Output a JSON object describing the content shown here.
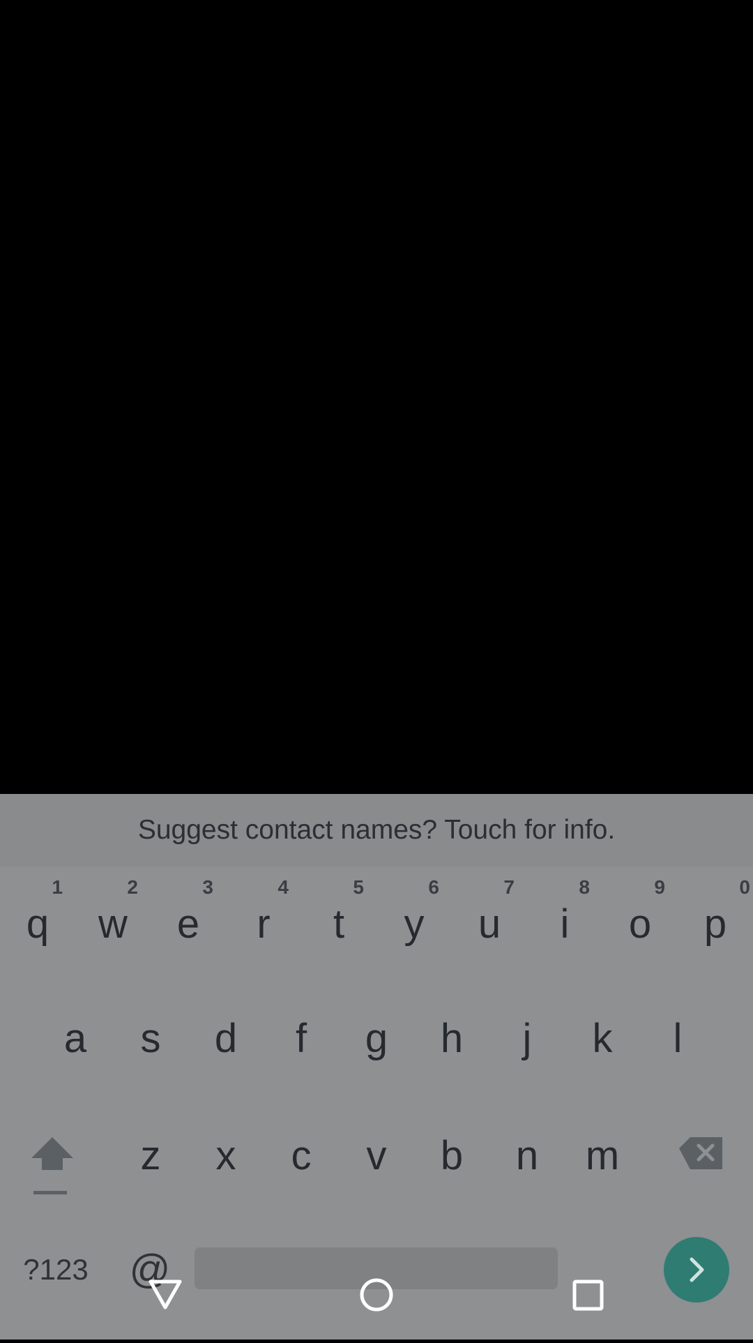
{
  "keyboard": {
    "suggestion": "Suggest contact names? Touch for info.",
    "row1": [
      {
        "letter": "q",
        "hint": "1"
      },
      {
        "letter": "w",
        "hint": "2"
      },
      {
        "letter": "e",
        "hint": "3"
      },
      {
        "letter": "r",
        "hint": "4"
      },
      {
        "letter": "t",
        "hint": "5"
      },
      {
        "letter": "y",
        "hint": "6"
      },
      {
        "letter": "u",
        "hint": "7"
      },
      {
        "letter": "i",
        "hint": "8"
      },
      {
        "letter": "o",
        "hint": "9"
      },
      {
        "letter": "p",
        "hint": "0"
      }
    ],
    "row2": [
      "a",
      "s",
      "d",
      "f",
      "g",
      "h",
      "j",
      "k",
      "l"
    ],
    "row3": [
      "z",
      "x",
      "c",
      "v",
      "b",
      "n",
      "m"
    ],
    "symbols_label": "?123",
    "at_label": "@",
    "shift_icon": "shift-arrow-icon",
    "delete_icon": "backspace-icon",
    "enter_icon": "chevron-right-icon",
    "colors": {
      "keyboard_bg": "#8e9092",
      "enter_bg": "#2f7c73",
      "key_text": "#262a2e"
    }
  },
  "nav": {
    "back_icon": "triangle-back-icon",
    "home_icon": "circle-home-icon",
    "recents_icon": "square-recents-icon"
  }
}
